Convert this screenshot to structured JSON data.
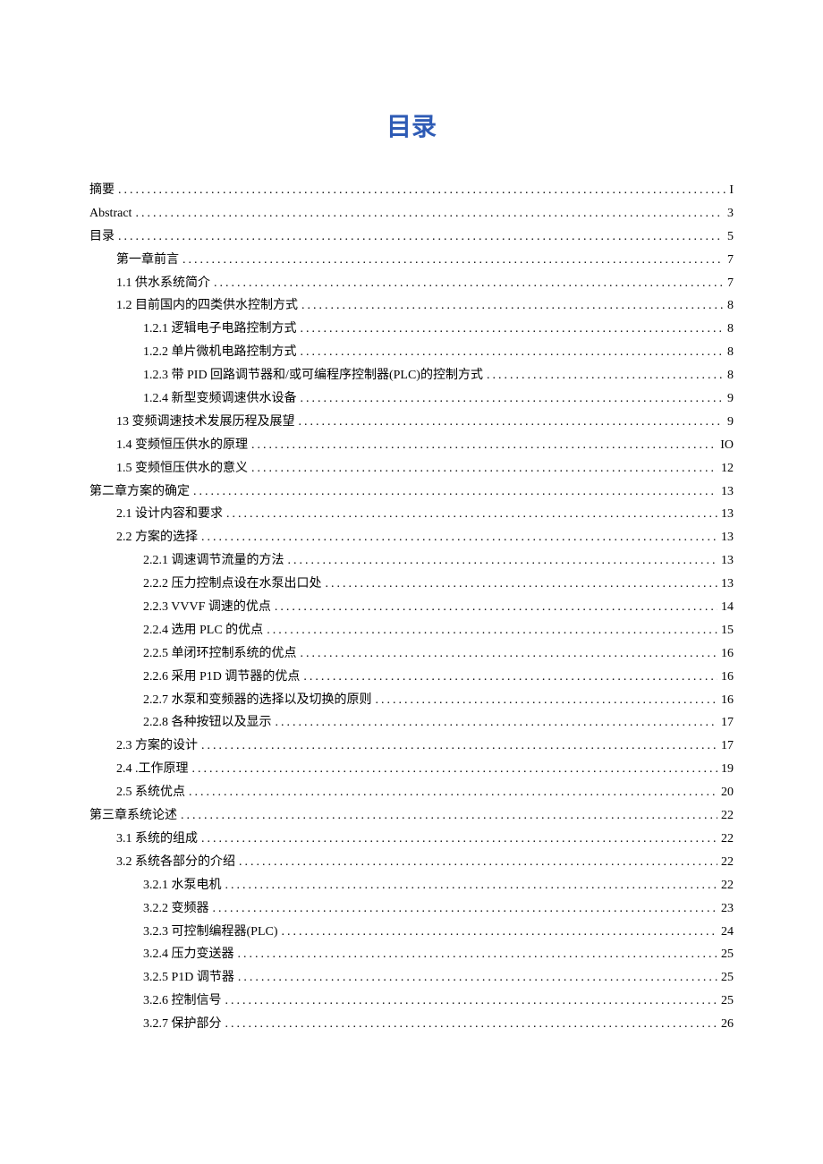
{
  "title": "目录",
  "entries": [
    {
      "indent": 0,
      "label": "摘要",
      "page": "I"
    },
    {
      "indent": 0,
      "label": "Abstract",
      "page": "3"
    },
    {
      "indent": 0,
      "label": "目录",
      "page": "5"
    },
    {
      "indent": 1,
      "label": "第一章前言",
      "page": "7"
    },
    {
      "indent": 1,
      "label": "1.1 供水系统简介",
      "page": "7"
    },
    {
      "indent": 1,
      "label": "1.2 目前国内的四类供水控制方式",
      "page": "8"
    },
    {
      "indent": 2,
      "label": "1.2.1 逻辑电子电路控制方式",
      "page": "8"
    },
    {
      "indent": 2,
      "label": "1.2.2 单片微机电路控制方式",
      "page": "8"
    },
    {
      "indent": 2,
      "label": "1.2.3 带 PID 回路调节器和/或可编程序控制器(PLC)的控制方式",
      "page": "8"
    },
    {
      "indent": 2,
      "label": "1.2.4 新型变频调速供水设备",
      "page": "9"
    },
    {
      "indent": 1,
      "label": "13 变频调速技术发展历程及展望",
      "page": "9"
    },
    {
      "indent": 1,
      "label": "1.4  变频恒压供水的原理",
      "page": "IO"
    },
    {
      "indent": 1,
      "label": "1.5  变频恒压供水的意义",
      "page": "12"
    },
    {
      "indent": 0,
      "label": "第二章方案的确定",
      "page": "13"
    },
    {
      "indent": 1,
      "label": "2.1  设计内容和要求",
      "page": "13"
    },
    {
      "indent": 1,
      "label": "2.2  方案的选择",
      "page": "13"
    },
    {
      "indent": 2,
      "label": "2.2.1 调速调节流量的方法",
      "page": "13"
    },
    {
      "indent": 2,
      "label": "2.2.2 压力控制点设在水泵出口处",
      "page": "13"
    },
    {
      "indent": 2,
      "label": "2.2.3 VVVF 调速的优点",
      "page": "14"
    },
    {
      "indent": 2,
      "label": "2.2.4 选用 PLC 的优点",
      "page": "15"
    },
    {
      "indent": 2,
      "label": "2.2.5 单闭环控制系统的优点",
      "page": "16"
    },
    {
      "indent": 2,
      "label": "2.2.6 采用 P1D 调节器的优点",
      "page": "16"
    },
    {
      "indent": 2,
      "label": "2.2.7 水泵和变频器的选择以及切换的原则",
      "page": "16"
    },
    {
      "indent": 2,
      "label": "2.2.8 各种按钮以及显示",
      "page": "17"
    },
    {
      "indent": 1,
      "label": "2.3  方案的设计",
      "page": "17"
    },
    {
      "indent": 1,
      "label": "2.4  .工作原理",
      "page": "19"
    },
    {
      "indent": 1,
      "label": "2.5  系统优点",
      "page": "20"
    },
    {
      "indent": 0,
      "label": "第三章系统论述",
      "page": "22"
    },
    {
      "indent": 1,
      "label": "3.1  系统的组成",
      "page": "22"
    },
    {
      "indent": 1,
      "label": "3.2  系统各部分的介绍",
      "page": "22"
    },
    {
      "indent": 2,
      "label": "3.2.1 水泵电机",
      "page": "22"
    },
    {
      "indent": 2,
      "label": "3.2.2 变频器",
      "page": "23"
    },
    {
      "indent": 2,
      "label": "3.2.3 可控制编程器(PLC)",
      "page": "24"
    },
    {
      "indent": 2,
      "label": "3.2.4 压力变送器",
      "page": "25"
    },
    {
      "indent": 2,
      "label": "3.2.5 P1D 调节器",
      "page": "25"
    },
    {
      "indent": 2,
      "label": "3.2.6 控制信号",
      "page": "25"
    },
    {
      "indent": 2,
      "label": "3.2.7 保护部分",
      "page": "26"
    }
  ]
}
